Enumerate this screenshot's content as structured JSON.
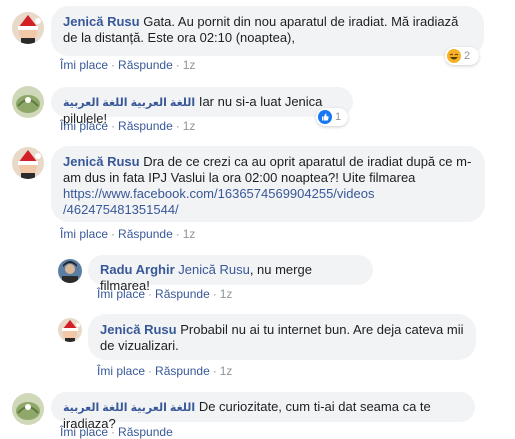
{
  "actions": {
    "like": "Îmi place",
    "reply": "Răspunde",
    "separator": "·"
  },
  "comments": [
    {
      "author": "Jenică Rusu",
      "text": "Gata. Au pornit din nou aparatul de iradiat. Mă iradiază de la distanță. Este ora 02:10 (noaptea),",
      "time": "1z",
      "reaction": {
        "type": "haha",
        "count": "2"
      }
    },
    {
      "author": "اللغة العربية اللغة العربية",
      "text": "Iar nu si-a luat Jenica pilulele!",
      "time": "1z",
      "reaction": {
        "type": "like",
        "count": "1"
      }
    },
    {
      "author": "Jenică Rusu",
      "text": "Dra de ce crezi ca au oprit aparatul de iradiat după ce m-am dus in fata IPJ Vaslui la ora 02:00 noaptea?! Uite filmarea",
      "link_line1": "https://www.facebook.com/1636574569904255/videos",
      "link_line2": "/462475481351544/",
      "time": "1z"
    },
    {
      "author": "Radu Arghir",
      "mention": "Jenică Rusu",
      "text": ", nu merge filmarea!",
      "time": "1z"
    },
    {
      "author": "Jenică Rusu",
      "text": "Probabil nu ai tu internet bun. Are deja cateva mii de vizualizari.",
      "time": "1z"
    },
    {
      "author": "اللغة العربية اللغة العربية",
      "text": "De curiozitate, cum ti-ai dat seama ca te iradiaza?",
      "time": ""
    }
  ],
  "colors": {
    "link": "#385898",
    "bubble": "#f2f3f5",
    "meta": "#90949c"
  }
}
